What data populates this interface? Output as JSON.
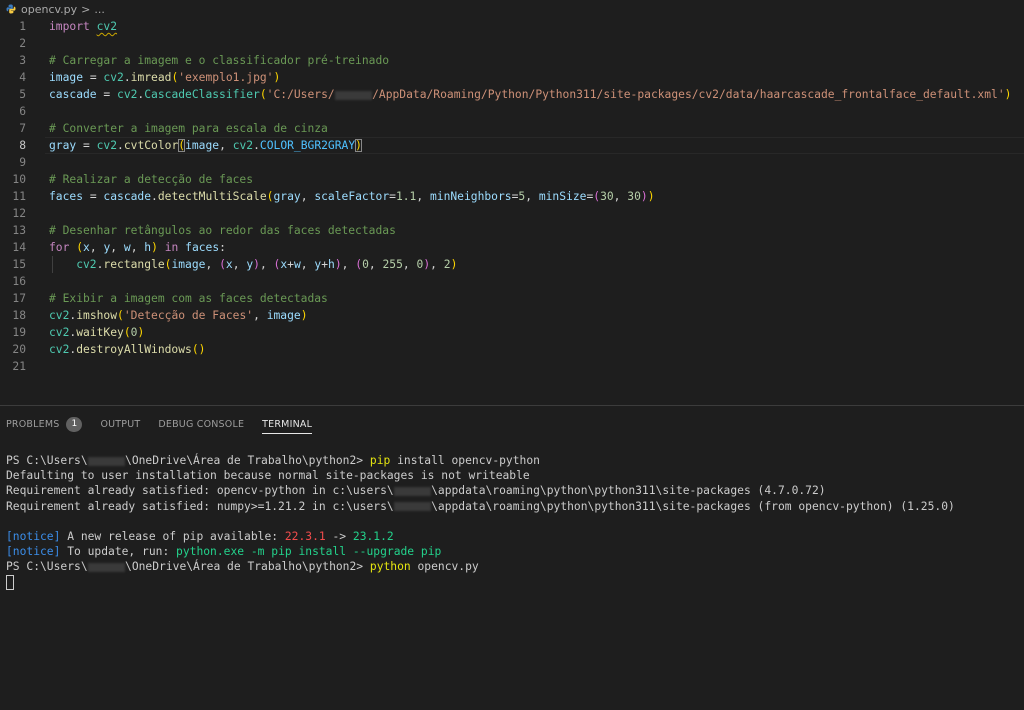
{
  "breadcrumb": {
    "file": "opencv.py",
    "separator": ">",
    "more": "..."
  },
  "editor": {
    "line_numbers": [
      "1",
      "2",
      "3",
      "4",
      "5",
      "6",
      "7",
      "8",
      "9",
      "10",
      "11",
      "12",
      "13",
      "14",
      "15",
      "16",
      "17",
      "18",
      "19",
      "20",
      "21"
    ],
    "active_line": 8
  },
  "code": {
    "l1": {
      "import": "import",
      "module": "cv2"
    },
    "l4": "# Carregar a imagem e o classificador pré-treinado",
    "l5": {
      "image": "image",
      "eq": " = ",
      "cv2": "cv2",
      "dot": ".",
      "imread": "imread",
      "open": "(",
      "arg": "'exemplo1.jpg'",
      "close": ")"
    },
    "l6": {
      "cascade": "cascade",
      "eq": " = ",
      "cv2": "cv2",
      "dot": ".",
      "cls": "CascadeClassifier",
      "open": "(",
      "path_pre": "'C:/Users/",
      "path_post": "/AppData/Roaming/Python/Python311/site-packages/cv2/data/haarcascade_frontalface_default.xml'",
      "close": ")"
    },
    "l7": "# Converter a imagem para escala de cinza",
    "l8": {
      "gray": "gray",
      "eq": " = ",
      "cv2": "cv2",
      "dot": ".",
      "fn": "cvtColor",
      "open": "(",
      "image": "image",
      "comma": ", ",
      "cv2b": "cv2",
      "dot2": ".",
      "const": "COLOR_BGR2GRAY",
      "close": ")"
    },
    "l10": "# Realizar a detecção de faces",
    "l11": {
      "faces": "faces",
      "eq": " = ",
      "cascade": "cascade",
      "dot": ".",
      "fn": "detectMultiScale",
      "open": "(",
      "gray": "gray",
      "c1": ", ",
      "sf": "scaleFactor",
      "eq1": "=",
      "v1": "1.1",
      "c2": ", ",
      "mn": "minNeighbors",
      "eq2": "=",
      "v2": "5",
      "c3": ", ",
      "ms": "minSize",
      "eq3": "=",
      "topen": "(",
      "v3": "30",
      "c4": ", ",
      "v4": "30",
      "tclose": ")",
      "close": ")"
    },
    "l13": "# Desenhar retângulos ao redor das faces detectadas",
    "l14": {
      "for": "for",
      "sp1": " ",
      "open": "(",
      "x": "x",
      "c1": ", ",
      "y": "y",
      "c2": ", ",
      "w": "w",
      "c3": ", ",
      "h": "h",
      "close": ")",
      "sp2": " ",
      "in": "in",
      "sp3": " ",
      "faces": "faces",
      "colon": ":"
    },
    "l15": {
      "cv2": "cv2",
      "dot": ".",
      "fn": "rectangle",
      "open": "(",
      "image": "image",
      "c1": ", ",
      "p1o": "(",
      "x": "x",
      "c2": ", ",
      "y": "y",
      "p1c": ")",
      "c3": ", ",
      "p2o": "(",
      "x2": "x",
      "plus1": "+",
      "w": "w",
      "c4": ", ",
      "y2": "y",
      "plus2": "+",
      "h": "h",
      "p2c": ")",
      "c5": ", ",
      "p3o": "(",
      "n0": "0",
      "c6": ", ",
      "n255": "255",
      "c7": ", ",
      "n0b": "0",
      "p3c": ")",
      "c8": ", ",
      "n2": "2",
      "close": ")"
    },
    "l17": "# Exibir a imagem com as faces detectadas",
    "l18": {
      "cv2": "cv2",
      "dot": ".",
      "fn": "imshow",
      "open": "(",
      "title": "'Detecção de Faces'",
      "comma": ", ",
      "image": "image",
      "close": ")"
    },
    "l19": {
      "cv2": "cv2",
      "dot": ".",
      "fn": "waitKey",
      "open": "(",
      "num": "0",
      "close": ")"
    },
    "l20": {
      "cv2": "cv2",
      "dot": ".",
      "fn": "destroyAllWindows",
      "open": "(",
      "close": ")"
    }
  },
  "panel": {
    "tabs": [
      {
        "label": "PROBLEMS",
        "badge": "1"
      },
      {
        "label": "OUTPUT"
      },
      {
        "label": "DEBUG CONSOLE"
      },
      {
        "label": "TERMINAL"
      }
    ]
  },
  "terminal": {
    "prompt_pre": "PS C:\\Users\\",
    "prompt_post": "\\OneDrive\\Área de Trabalho\\python2> ",
    "cmd1_pip": "pip",
    "cmd1_rest": " install opencv-python",
    "line2": "Defaulting to user installation because normal site-packages is not writeable",
    "line3_pre": "Requirement already satisfied: opencv-python in c:\\users\\",
    "line3_post": "\\appdata\\roaming\\python\\python311\\site-packages (4.7.0.72)",
    "line4_pre": "Requirement already satisfied: numpy>=1.21.2 in c:\\users\\",
    "line4_post": "\\appdata\\roaming\\python\\python311\\site-packages (from opencv-python) (1.25.0)",
    "notice_tag": "[notice]",
    "notice1_text": " A new release of pip available: ",
    "old_version": "22.3.1",
    "arrow": " -> ",
    "new_version": "23.1.2",
    "notice2_text": " To update, run: ",
    "upgrade_cmd": "python.exe -m pip install --upgrade pip",
    "cmd2_python": "python",
    "cmd2_rest": " opencv.py"
  }
}
